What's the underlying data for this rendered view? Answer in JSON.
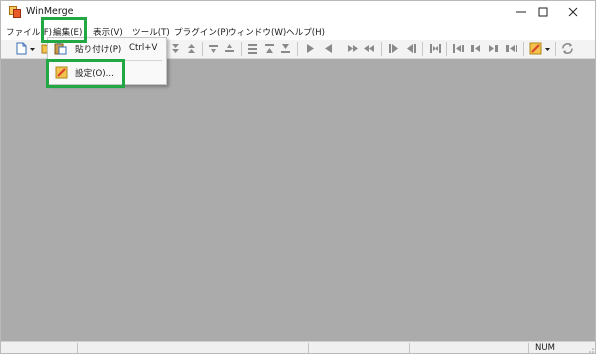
{
  "window": {
    "title": "WinMerge",
    "app_icon": "winmerge-icon"
  },
  "window_controls": {
    "minimize": "minimize-icon",
    "maximize": "maximize-icon",
    "close": "close-icon"
  },
  "menubar": {
    "items": [
      "ファイル(F)",
      "編集(E)",
      "表示(V)",
      "ツール(T)",
      "プラグイン(P)",
      "ウィンドウ(W)",
      "ヘルプ(H)"
    ]
  },
  "edit_menu": {
    "items": [
      {
        "label": "貼り付け(P)",
        "shortcut": "Ctrl+V",
        "icon": "paste-icon"
      },
      {
        "label": "設定(O)...",
        "icon": "settings-icon"
      }
    ]
  },
  "highlights": {
    "color": "#22a745",
    "targets": [
      "edit-menu",
      "settings-item"
    ]
  },
  "statusbar": {
    "num": "NUM"
  },
  "colors": {
    "client_bg": "#ababab",
    "menu_bg": "#ffffff",
    "toolbar_bg": "#f3f3f3"
  }
}
